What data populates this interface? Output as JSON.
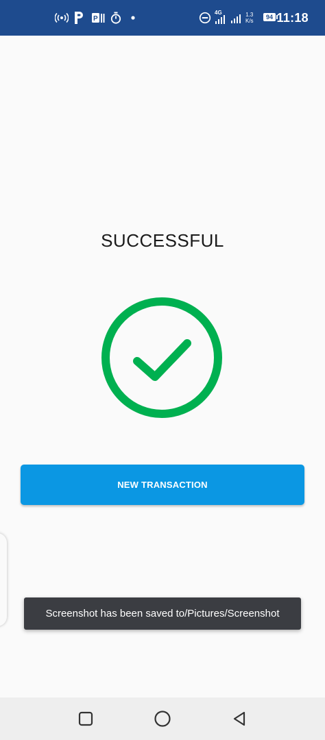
{
  "status_bar": {
    "time": "11:18",
    "battery_level": "94",
    "network_type": "4G",
    "net_speed_value": "1.3",
    "net_speed_unit": "K/s",
    "background_color": "#1e4b8e",
    "icons": [
      "hotspot-icon",
      "p-app-icon",
      "parking-icon",
      "timer-icon",
      "dot-icon",
      "dnd-icon",
      "signal-icon",
      "signal-icon-2",
      "battery-icon"
    ]
  },
  "main": {
    "title": "SUCCESSFUL",
    "status_icon": "check-circle-icon",
    "success_color": "#00b050",
    "new_transaction_label": "NEW TRANSACTION",
    "button_color": "#0b97e3"
  },
  "toast": {
    "message": "Screenshot has been saved to/Pictures/Screenshot"
  },
  "nav_bar": {
    "icons": [
      "recents-square-icon",
      "home-circle-icon",
      "back-triangle-icon"
    ]
  }
}
